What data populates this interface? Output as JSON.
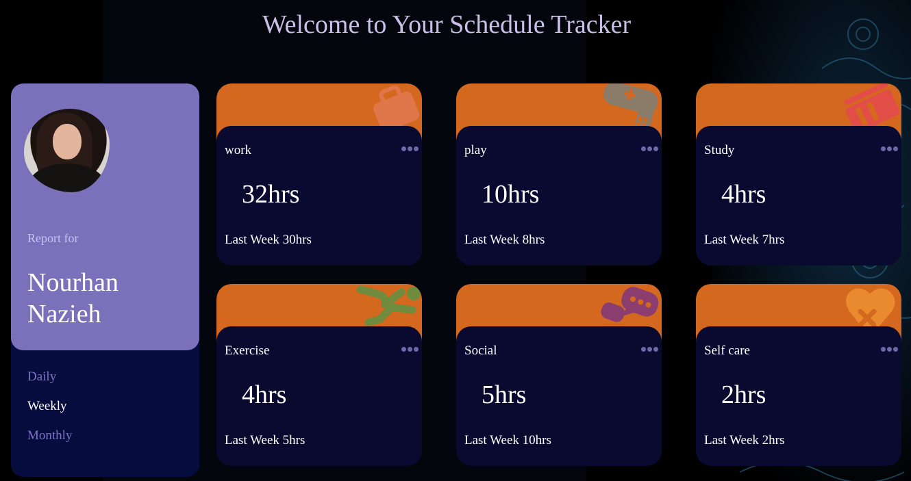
{
  "header": {
    "title": "Welcome to Your Schedule Tracker"
  },
  "profile": {
    "report_label": "Report for",
    "name": "Nourhan Nazieh",
    "periods": [
      {
        "label": "Daily",
        "active": false
      },
      {
        "label": "Weekly",
        "active": true
      },
      {
        "label": "Monthly",
        "active": false
      }
    ]
  },
  "colors": {
    "card_top": "#d5681f",
    "card_body": "#0a0a30",
    "profile_top": "#7b71ba",
    "profile_bottom": "#070c3e",
    "title": "#cbbfe8"
  },
  "cards": [
    {
      "title": "work",
      "hours": "32hrs",
      "last_week": "Last Week 30hrs",
      "icon": "briefcase-icon"
    },
    {
      "title": "play",
      "hours": "10hrs",
      "last_week": "Last Week 8hrs",
      "icon": "gamepad-icon"
    },
    {
      "title": "Study",
      "hours": "4hrs",
      "last_week": "Last Week 7hrs",
      "icon": "book-icon"
    },
    {
      "title": "Exercise",
      "hours": "4hrs",
      "last_week": "Last Week 5hrs",
      "icon": "running-person-icon"
    },
    {
      "title": "Social",
      "hours": "5hrs",
      "last_week": "Last Week 10hrs",
      "icon": "chat-bubbles-icon"
    },
    {
      "title": "Self care",
      "hours": "2hrs",
      "last_week": "Last Week 2hrs",
      "icon": "heart-bandage-icon"
    }
  ]
}
